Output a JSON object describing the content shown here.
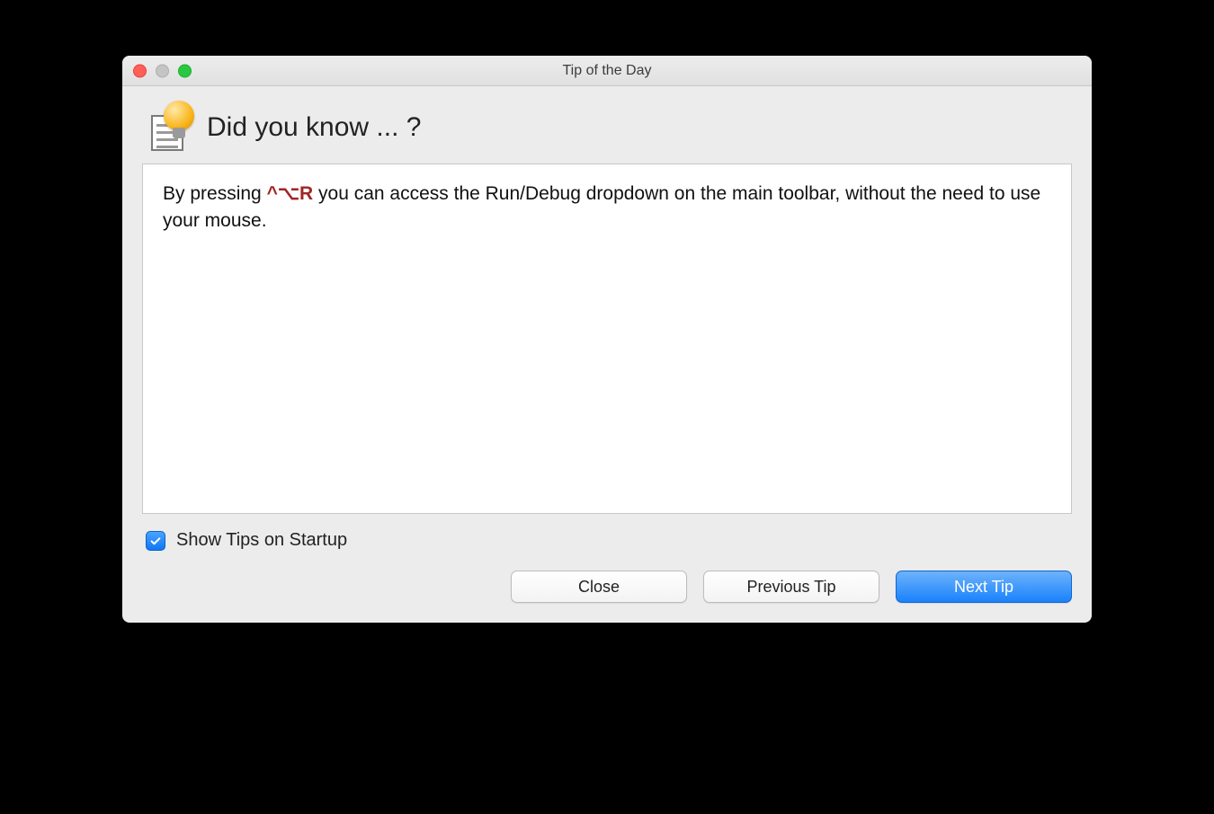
{
  "window": {
    "title": "Tip of the Day"
  },
  "header": {
    "title": "Did you know ... ?"
  },
  "tip": {
    "pre": "By pressing ",
    "shortcut": "^⌥R",
    "post": " you can access the Run/Debug dropdown on the main toolbar, without the need to use your mouse."
  },
  "footer": {
    "checkbox_label": "Show Tips on Startup",
    "checkbox_checked": true,
    "buttons": {
      "close": "Close",
      "previous": "Previous Tip",
      "next": "Next Tip"
    }
  }
}
